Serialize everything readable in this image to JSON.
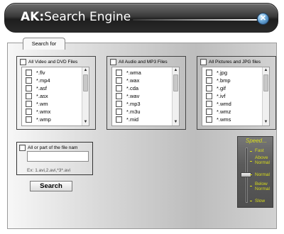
{
  "window": {
    "title_brand": "AK:",
    "title_rest": "Search Engine",
    "close_symbol": "✕"
  },
  "tab": {
    "label": "Search for"
  },
  "groups": [
    {
      "header": "All Video and DVD Files",
      "items": [
        "*.flv",
        "*.mp4",
        "*.asf",
        "*.asx",
        "*.wm",
        "*.wmx",
        "*.wmp"
      ]
    },
    {
      "header": "All Audio and MP3 Files",
      "items": [
        "*.wma",
        "*.wax",
        "*.cda",
        "*.wav",
        "*.mp3",
        "*.m3u",
        "*.mid"
      ]
    },
    {
      "header": "All Pictures and JPG files",
      "items": [
        "*.jpg",
        "*.bmp",
        "*.gif",
        "*.ivf",
        "*.wmd",
        "*.wmz",
        "*.wms"
      ]
    }
  ],
  "name_search": {
    "label": "All or part of the file nam",
    "value": "",
    "hint": "Ex: 1.avi,2.avi,*3*.avi",
    "button": "Search"
  },
  "speed": {
    "title": "Speed...",
    "labels": [
      "Fast",
      "Above Normal",
      "Normal",
      "Below Normal",
      "Slow"
    ],
    "level": "Normal"
  }
}
